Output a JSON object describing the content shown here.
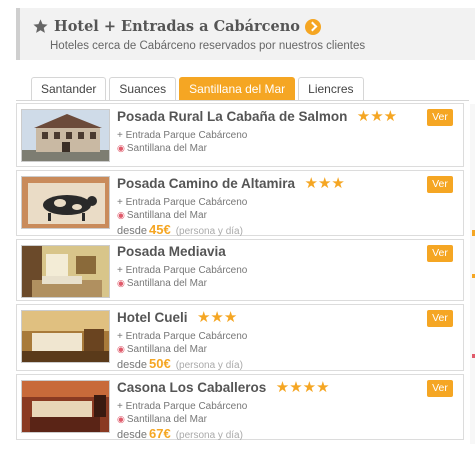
{
  "header": {
    "title": "Hotel + Entradas a Cabárceno",
    "subtitle": "Hoteles cerca de Cabárceno reservados por nuestros clientes"
  },
  "tabs": [
    {
      "label": "Santander",
      "active": false
    },
    {
      "label": "Suances",
      "active": false
    },
    {
      "label": "Santillana del Mar",
      "active": true
    },
    {
      "label": "Liencres",
      "active": false
    }
  ],
  "hotels": [
    {
      "name": "Posada Rural La Cabaña de Salmon",
      "stars": "★★★",
      "entrada": "+ Entrada Parque Cabárceno",
      "location": "Santillana del Mar",
      "price_prefix": "",
      "price": "",
      "price_note": "",
      "cta": "Ver"
    },
    {
      "name": "Posada Camino de Altamira",
      "stars": "★★★",
      "entrada": "+ Entrada Parque Cabárceno",
      "location": "Santillana del Mar",
      "price_prefix": "desde",
      "price": "45€",
      "price_note": "(persona y día)",
      "cta": "Ver"
    },
    {
      "name": "Posada Mediavia",
      "stars": "",
      "entrada": "+ Entrada Parque Cabárceno",
      "location": "Santillana del Mar",
      "price_prefix": "",
      "price": "",
      "price_note": "",
      "cta": "Ver"
    },
    {
      "name": "Hotel Cueli",
      "stars": "★★★",
      "entrada": "+ Entrada Parque Cabárceno",
      "location": "Santillana del Mar",
      "price_prefix": "desde",
      "price": "50€",
      "price_note": "(persona y día)",
      "cta": "Ver"
    },
    {
      "name": "Casona Los Caballeros",
      "stars": "★★★★",
      "entrada": "+ Entrada Parque Cabárceno",
      "location": "Santillana del Mar",
      "price_prefix": "desde",
      "price": "67€",
      "price_note": "(persona y día)",
      "cta": "Ver"
    }
  ],
  "icons": {
    "header": "star-icon",
    "title_link": "arrow-right-circle-icon",
    "location": "map-pin-icon"
  },
  "colors": {
    "accent": "#f5a623",
    "pin": "#e05a6a",
    "text": "#555555"
  }
}
